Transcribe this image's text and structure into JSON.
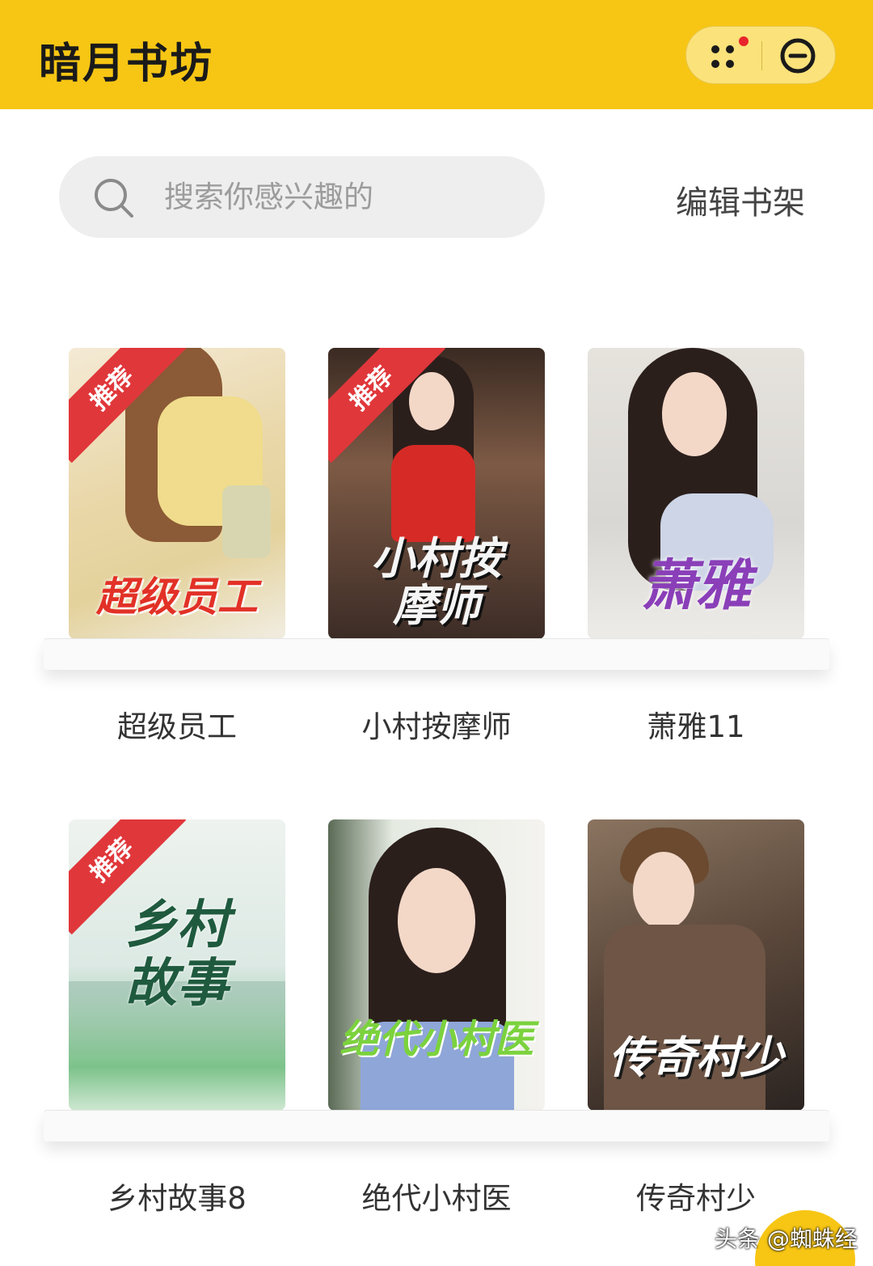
{
  "header": {
    "title": "暗月书坊"
  },
  "search": {
    "placeholder": "搜索你感兴趣的"
  },
  "toolbar": {
    "edit_label": "编辑书架"
  },
  "ribbon_label": "推荐",
  "books": [
    {
      "name": "超级员工",
      "cover_title": "超级员工",
      "recommended": true
    },
    {
      "name": "小村按摩师",
      "cover_title": "小村按摩师",
      "recommended": true
    },
    {
      "name": "萧雅11",
      "cover_title": "萧雅",
      "recommended": false
    },
    {
      "name": "乡村故事8",
      "cover_title": "乡村故事",
      "recommended": true
    },
    {
      "name": "绝代小村医",
      "cover_title": "绝代小村医",
      "recommended": false
    },
    {
      "name": "传奇村少",
      "cover_title": "传奇村少",
      "recommended": false
    }
  ],
  "watermark": "头条 @蜘蛛经",
  "colors": {
    "header_bg": "#f7c614",
    "ribbon": "#e0373b",
    "notification_dot": "#e8252b"
  }
}
